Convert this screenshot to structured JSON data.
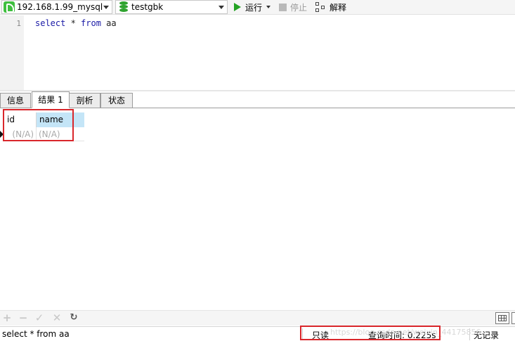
{
  "toolbar": {
    "connection": "192.168.1.99_mysql",
    "database": "testgbk",
    "run_label": "运行",
    "stop_label": "停止",
    "explain_label": "解释"
  },
  "editor": {
    "line_numbers": [
      "1"
    ],
    "query_parts": [
      "select",
      " * ",
      "from",
      " aa"
    ]
  },
  "tabs": [
    {
      "label": "信息",
      "active": false
    },
    {
      "label": "结果 1",
      "active": true
    },
    {
      "label": "剖析",
      "active": false
    },
    {
      "label": "状态",
      "active": false
    }
  ],
  "result_grid": {
    "columns": [
      "id",
      "name"
    ],
    "rows": [
      [
        "(N/A)",
        "(N/A)"
      ]
    ]
  },
  "nav_buttons": [
    {
      "name": "add-record-button",
      "glyph": "+"
    },
    {
      "name": "delete-record-button",
      "glyph": "−"
    },
    {
      "name": "apply-button",
      "glyph": "✓"
    },
    {
      "name": "discard-button",
      "glyph": "✕"
    },
    {
      "name": "refresh-button",
      "glyph": "↻"
    }
  ],
  "statusbar": {
    "sql": "select * from aa",
    "readonly": "只读",
    "query_time": "查询时间: 0.225s",
    "records": "无记录"
  },
  "watermark": "https://blog.csdn.net/weixin_44175856",
  "colors": {
    "highlight": "#d9262b",
    "run_icon": "#24a324",
    "selected_column": "#c4e5f7"
  }
}
